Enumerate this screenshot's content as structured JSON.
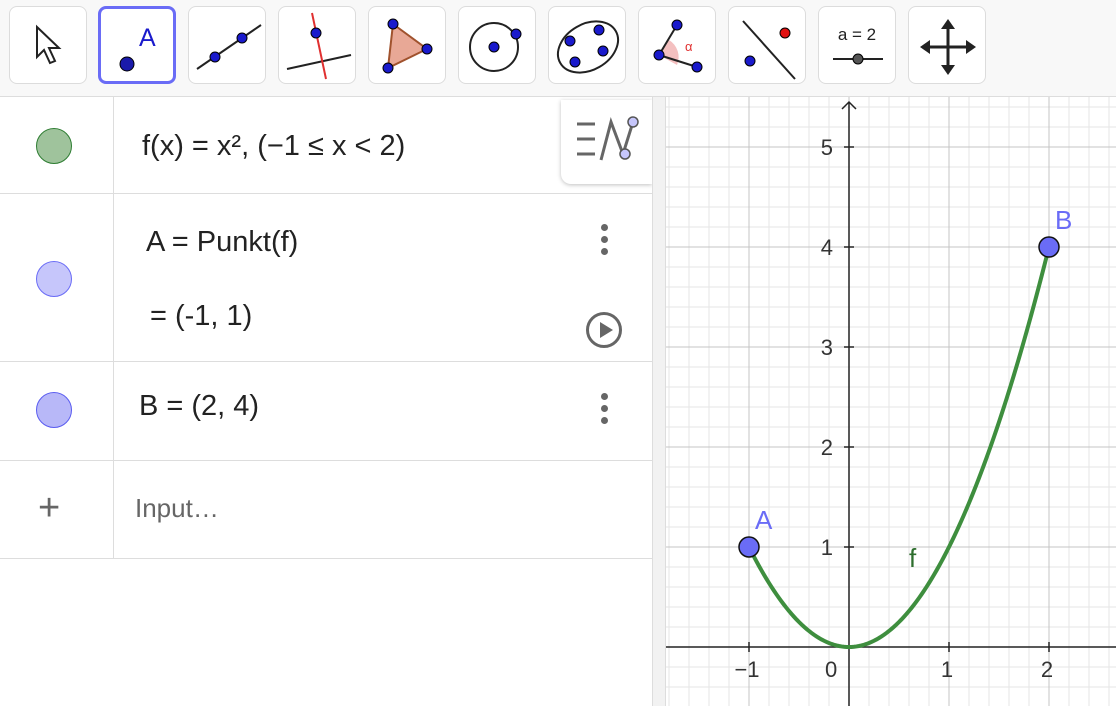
{
  "toolbar": {
    "tools": [
      {
        "name": "move-tool"
      },
      {
        "name": "point-tool",
        "label": "A",
        "active": true
      },
      {
        "name": "line-tool"
      },
      {
        "name": "perpendicular-line-tool"
      },
      {
        "name": "polygon-tool"
      },
      {
        "name": "circle-tool"
      },
      {
        "name": "conic-tool"
      },
      {
        "name": "angle-tool",
        "label": "α"
      },
      {
        "name": "reflect-tool"
      },
      {
        "name": "slider-tool",
        "label": "a = 2"
      },
      {
        "name": "move-graphics-view-tool"
      }
    ]
  },
  "algebra": {
    "rows": [
      {
        "color": "#9fc39c",
        "border": "#2e7d32",
        "expr": "f(x)  =  x², (−1 ≤ x < 2)"
      },
      {
        "color": "#c6c6fb",
        "border": "#6a6cf6",
        "expr": "A  =  Punkt(f)",
        "value": "=  (-1, 1)"
      },
      {
        "color": "#b8b8f8",
        "border": "#5a5cf0",
        "expr": "B = (2, 4)"
      }
    ],
    "input_placeholder": "Input…"
  },
  "graph": {
    "x_ticks": [
      "−1",
      "0",
      "1",
      "2"
    ],
    "y_ticks": [
      "1",
      "2",
      "3",
      "4",
      "5"
    ],
    "curve_label": "f",
    "curve_color": "#3e8e3e",
    "point_color": "#6a6cf6",
    "points": [
      {
        "label": "A",
        "x": -1,
        "y": 1
      },
      {
        "label": "B",
        "x": 2,
        "y": 4
      }
    ],
    "function": {
      "expr": "x^2",
      "x_min": -1,
      "x_max": 2
    }
  }
}
